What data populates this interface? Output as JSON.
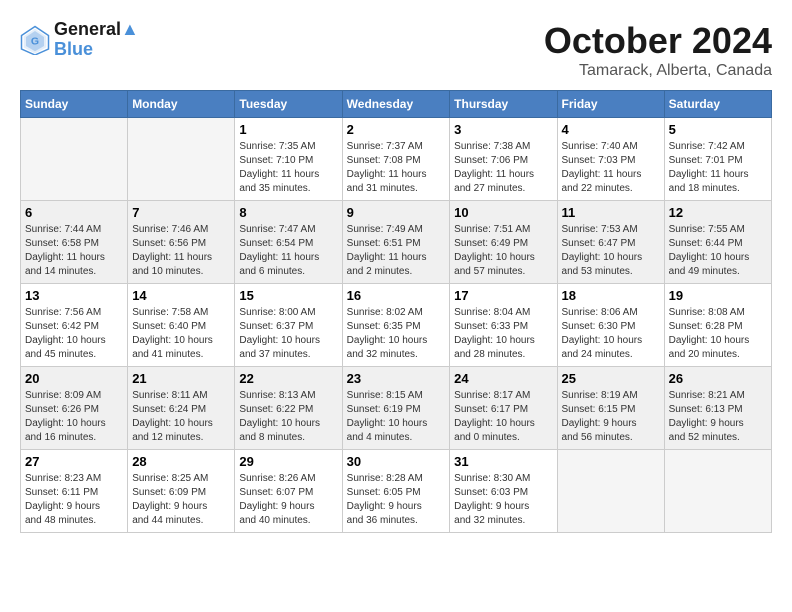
{
  "header": {
    "logo_line1": "General",
    "logo_line2": "Blue",
    "month": "October 2024",
    "location": "Tamarack, Alberta, Canada"
  },
  "weekdays": [
    "Sunday",
    "Monday",
    "Tuesday",
    "Wednesday",
    "Thursday",
    "Friday",
    "Saturday"
  ],
  "weeks": [
    [
      {
        "day": "",
        "info": ""
      },
      {
        "day": "",
        "info": ""
      },
      {
        "day": "1",
        "info": "Sunrise: 7:35 AM\nSunset: 7:10 PM\nDaylight: 11 hours\nand 35 minutes."
      },
      {
        "day": "2",
        "info": "Sunrise: 7:37 AM\nSunset: 7:08 PM\nDaylight: 11 hours\nand 31 minutes."
      },
      {
        "day": "3",
        "info": "Sunrise: 7:38 AM\nSunset: 7:06 PM\nDaylight: 11 hours\nand 27 minutes."
      },
      {
        "day": "4",
        "info": "Sunrise: 7:40 AM\nSunset: 7:03 PM\nDaylight: 11 hours\nand 22 minutes."
      },
      {
        "day": "5",
        "info": "Sunrise: 7:42 AM\nSunset: 7:01 PM\nDaylight: 11 hours\nand 18 minutes."
      }
    ],
    [
      {
        "day": "6",
        "info": "Sunrise: 7:44 AM\nSunset: 6:58 PM\nDaylight: 11 hours\nand 14 minutes."
      },
      {
        "day": "7",
        "info": "Sunrise: 7:46 AM\nSunset: 6:56 PM\nDaylight: 11 hours\nand 10 minutes."
      },
      {
        "day": "8",
        "info": "Sunrise: 7:47 AM\nSunset: 6:54 PM\nDaylight: 11 hours\nand 6 minutes."
      },
      {
        "day": "9",
        "info": "Sunrise: 7:49 AM\nSunset: 6:51 PM\nDaylight: 11 hours\nand 2 minutes."
      },
      {
        "day": "10",
        "info": "Sunrise: 7:51 AM\nSunset: 6:49 PM\nDaylight: 10 hours\nand 57 minutes."
      },
      {
        "day": "11",
        "info": "Sunrise: 7:53 AM\nSunset: 6:47 PM\nDaylight: 10 hours\nand 53 minutes."
      },
      {
        "day": "12",
        "info": "Sunrise: 7:55 AM\nSunset: 6:44 PM\nDaylight: 10 hours\nand 49 minutes."
      }
    ],
    [
      {
        "day": "13",
        "info": "Sunrise: 7:56 AM\nSunset: 6:42 PM\nDaylight: 10 hours\nand 45 minutes."
      },
      {
        "day": "14",
        "info": "Sunrise: 7:58 AM\nSunset: 6:40 PM\nDaylight: 10 hours\nand 41 minutes."
      },
      {
        "day": "15",
        "info": "Sunrise: 8:00 AM\nSunset: 6:37 PM\nDaylight: 10 hours\nand 37 minutes."
      },
      {
        "day": "16",
        "info": "Sunrise: 8:02 AM\nSunset: 6:35 PM\nDaylight: 10 hours\nand 32 minutes."
      },
      {
        "day": "17",
        "info": "Sunrise: 8:04 AM\nSunset: 6:33 PM\nDaylight: 10 hours\nand 28 minutes."
      },
      {
        "day": "18",
        "info": "Sunrise: 8:06 AM\nSunset: 6:30 PM\nDaylight: 10 hours\nand 24 minutes."
      },
      {
        "day": "19",
        "info": "Sunrise: 8:08 AM\nSunset: 6:28 PM\nDaylight: 10 hours\nand 20 minutes."
      }
    ],
    [
      {
        "day": "20",
        "info": "Sunrise: 8:09 AM\nSunset: 6:26 PM\nDaylight: 10 hours\nand 16 minutes."
      },
      {
        "day": "21",
        "info": "Sunrise: 8:11 AM\nSunset: 6:24 PM\nDaylight: 10 hours\nand 12 minutes."
      },
      {
        "day": "22",
        "info": "Sunrise: 8:13 AM\nSunset: 6:22 PM\nDaylight: 10 hours\nand 8 minutes."
      },
      {
        "day": "23",
        "info": "Sunrise: 8:15 AM\nSunset: 6:19 PM\nDaylight: 10 hours\nand 4 minutes."
      },
      {
        "day": "24",
        "info": "Sunrise: 8:17 AM\nSunset: 6:17 PM\nDaylight: 10 hours\nand 0 minutes."
      },
      {
        "day": "25",
        "info": "Sunrise: 8:19 AM\nSunset: 6:15 PM\nDaylight: 9 hours\nand 56 minutes."
      },
      {
        "day": "26",
        "info": "Sunrise: 8:21 AM\nSunset: 6:13 PM\nDaylight: 9 hours\nand 52 minutes."
      }
    ],
    [
      {
        "day": "27",
        "info": "Sunrise: 8:23 AM\nSunset: 6:11 PM\nDaylight: 9 hours\nand 48 minutes."
      },
      {
        "day": "28",
        "info": "Sunrise: 8:25 AM\nSunset: 6:09 PM\nDaylight: 9 hours\nand 44 minutes."
      },
      {
        "day": "29",
        "info": "Sunrise: 8:26 AM\nSunset: 6:07 PM\nDaylight: 9 hours\nand 40 minutes."
      },
      {
        "day": "30",
        "info": "Sunrise: 8:28 AM\nSunset: 6:05 PM\nDaylight: 9 hours\nand 36 minutes."
      },
      {
        "day": "31",
        "info": "Sunrise: 8:30 AM\nSunset: 6:03 PM\nDaylight: 9 hours\nand 32 minutes."
      },
      {
        "day": "",
        "info": ""
      },
      {
        "day": "",
        "info": ""
      }
    ]
  ]
}
